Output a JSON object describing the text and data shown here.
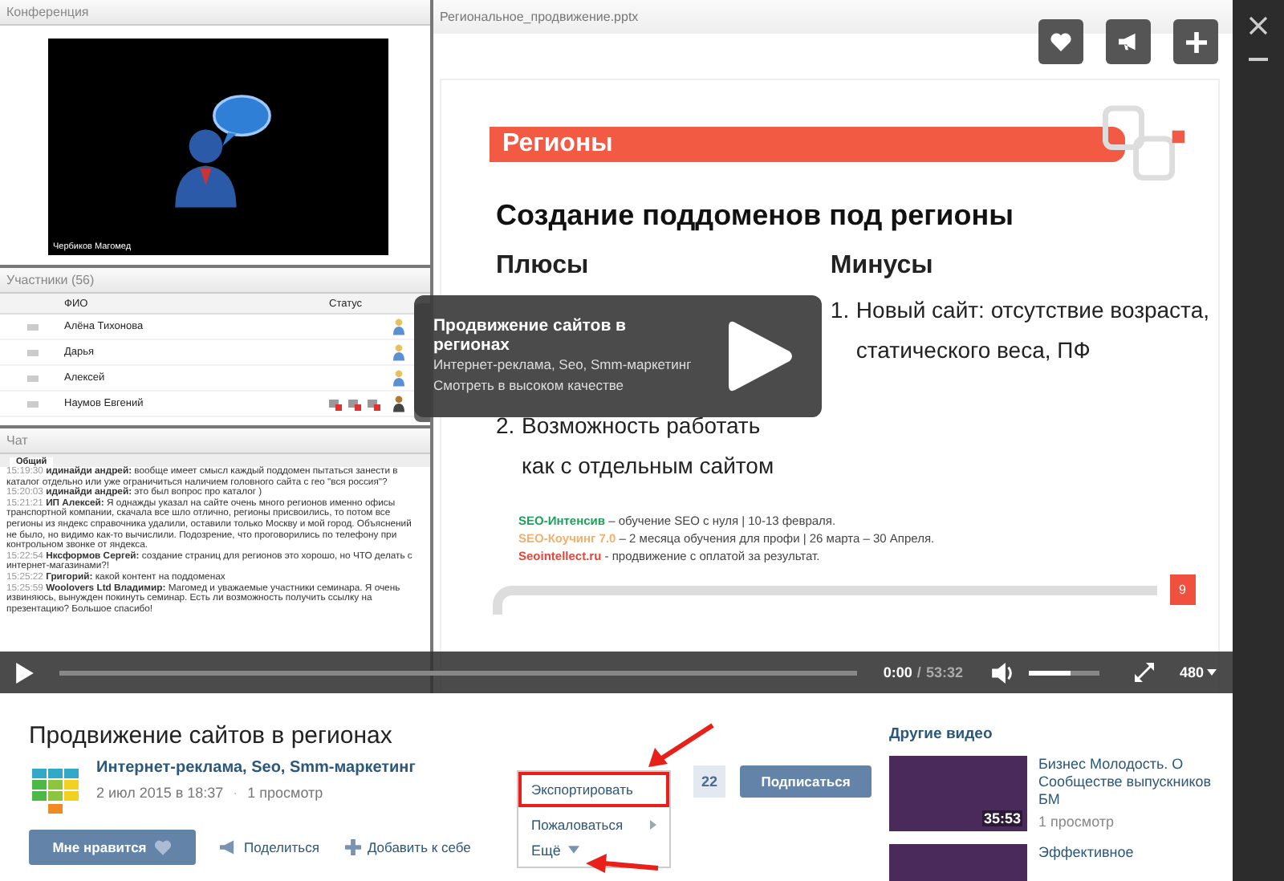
{
  "conference": {
    "title": "Конференция",
    "speaker": "Чербиков Магомед"
  },
  "participants": {
    "title": "Участники (56)",
    "columns": [
      "ФИО",
      "Статус"
    ],
    "rows": [
      {
        "name": "Алёна Тихонова",
        "media": false
      },
      {
        "name": "Дарья",
        "media": false
      },
      {
        "name": "Алексей",
        "media": false
      },
      {
        "name": "Наумов Евгений",
        "media": true
      }
    ]
  },
  "chat": {
    "title": "Чат",
    "tabs": [
      {
        "label": "Общий",
        "selected": true
      }
    ],
    "messages": [
      {
        "time": "15:19:30",
        "author": "идинайди андрей:",
        "text": "вообще имеет смысл каждый поддомен пытаться занести в каталог отдельно или уже ограничиться наличием головного сайта с гео \"вся россия\"?"
      },
      {
        "time": "15:20:03",
        "author": "идинайди андрей:",
        "text": "это был вопрос про каталог )"
      },
      {
        "time": "15:21:21",
        "author": "ИП Алексей:",
        "text": "Я однажды указал на сайте очень много регионов именно офисы транспортной компании, скачала все шло отлично, регионы присвоились, то потом все регионы из яндекс справочника удалили, оставили только Москву и мой город. Объяснений не было, но видимо как-то вычислили. Подозрение, что проговорились по телефону при контрольном звонке от яндекса."
      },
      {
        "time": "15:22:54",
        "author": "Нксформов Сергей:",
        "text": "создание страниц для регионов это хорошо, но ЧТО делать с интернет-магазинами?!"
      },
      {
        "time": "15:25:22",
        "author": "Григорий:",
        "text": "какой контент на поддоменах"
      },
      {
        "time": "15:25:59",
        "author": "Woolovers Ltd Владимир:",
        "text": "Магомед и уважаемые участники семинара. Я очень извиняюсь, вынужден покинуть семинар. Есть ли возможность получить ссылку на презентацию? Большое спасибо!"
      }
    ]
  },
  "presentation": {
    "file": "Региональное_продвижение.pptx",
    "banner": "Регионы",
    "heading": "Создание поддоменов под регионы",
    "columns": [
      {
        "title": "Плюсы",
        "items": [
          {
            "number": "2.",
            "text": "Возможность работать как с отдельным сайтом"
          }
        ]
      },
      {
        "title": "Минусы",
        "items": [
          {
            "number": "1.",
            "text": "Новый сайт: отсутствие возраста, статического веса, ПФ"
          }
        ]
      }
    ],
    "promo": [
      {
        "name": "SEO-Интенсив",
        "color": "#1ea05a",
        "text": " – обучение SEO с нуля | 10-13 февраля."
      },
      {
        "name": "SEO-Коучинг 7.0",
        "color": "#f0b070",
        "text": " – 2 месяца обучения для профи | 26 марта – 30 Апреля."
      },
      {
        "name": "Seointellect.ru",
        "color": "#e8463a",
        "text": "  - продвижение  с оплатой за результат."
      }
    ],
    "page": "9"
  },
  "player": {
    "overlay": {
      "title": "Продвижение сайтов в регионах",
      "channel": "Интернет-реклама, Seo, Smm-маркетинг",
      "hint": "Смотреть в высоком качестве"
    },
    "elapsed": "0:00",
    "separator": "/",
    "duration": "53:32",
    "volume": {
      "level": 0.6
    },
    "quality": "480"
  },
  "video": {
    "title": "Продвижение сайтов в регионах",
    "channel": "Интернет-реклама, Seo, Smm-маркетинг",
    "date": "2 июл 2015 в 18:37",
    "dot": "·",
    "views": "1 просмотр",
    "actions": [
      {
        "kind": "like",
        "label": "Мне нравится"
      },
      {
        "kind": "share",
        "label": "Поделиться"
      },
      {
        "kind": "add",
        "label": "Добавить к себе"
      },
      {
        "kind": "more",
        "label": "Ещё"
      }
    ],
    "menu": {
      "expanded": true,
      "items": [
        {
          "label": "Экспортировать",
          "highlighted": true,
          "submenu": false
        },
        {
          "label": "Пожаловаться",
          "highlighted": false,
          "submenu": true
        }
      ]
    },
    "subscribers": "22",
    "subscribe": "Подписаться"
  },
  "other_videos": {
    "title": "Другие видео",
    "items": [
      {
        "title": "Бизнес Молодость. О Сообществе выпускников БМ",
        "duration": "35:53",
        "views": "1 просмотр"
      },
      {
        "title": "Эффективное"
      }
    ]
  }
}
